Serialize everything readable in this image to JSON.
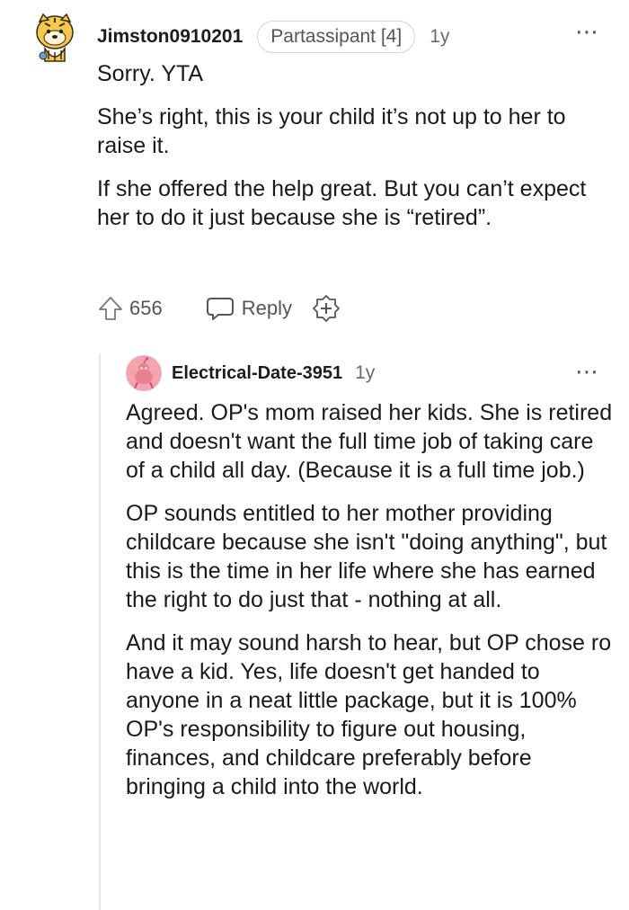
{
  "comments": [
    {
      "username": "Jimston0910201",
      "flair": "Partassipant [4]",
      "age": "1y",
      "more_icon": "⋯",
      "paragraphs": [
        "Sorry. YTA",
        "She’s right, this is your child it’s not up to her to raise it.",
        "If she offered the help great. But you can’t expect her to do it just because she is “retired”."
      ],
      "votes": "656",
      "reply_label": "Reply"
    },
    {
      "username": "Electrical-Date-3951",
      "age": "1y",
      "more_icon": "⋯",
      "paragraphs": [
        "Agreed. OP's mom raised her kids. She is retired and doesn't want the full time job of taking care of a child all day. (Because it is a full time job.)",
        "OP sounds entitled to her mother providing childcare because she isn't \"doing anything\", but this is the time in her life where she has earned the right to do just that - nothing at all.",
        "And it may sound harsh to hear, but OP chose ro have a kid. Yes, life doesn't get handed to anyone in a neat little package, but it is 100% OP's responsibility to figure out housing, finances, and childcare preferably before bringing a child into the world."
      ]
    }
  ],
  "colors": {
    "text": "#1a1a1b",
    "muted": "#6b6b6b",
    "avatar_pink": "#f5a3ad"
  }
}
